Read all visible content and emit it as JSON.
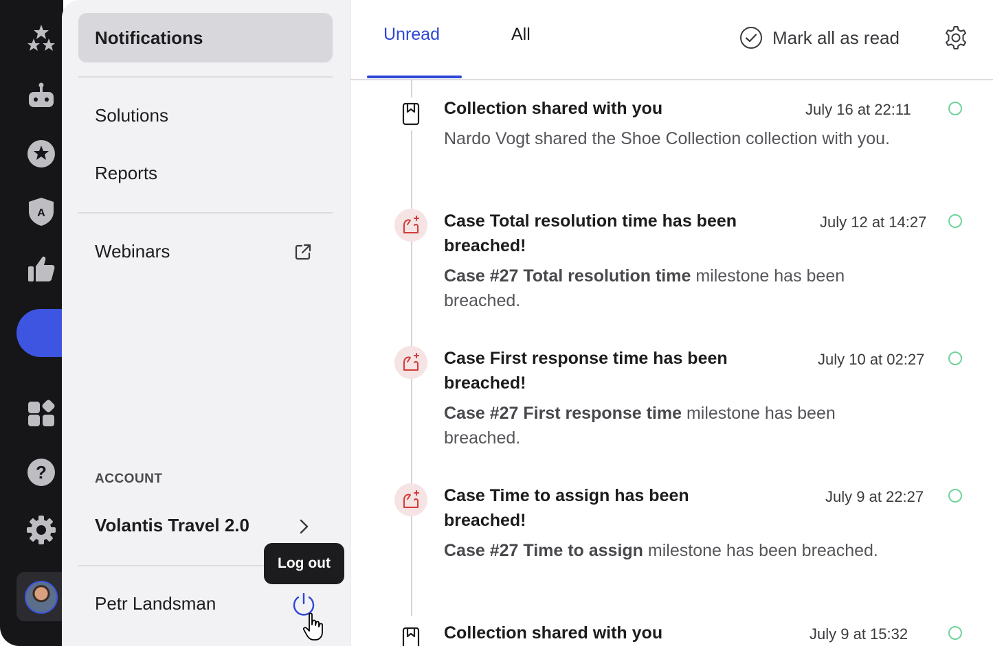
{
  "sidebar": {
    "items": [
      {
        "label": "Notifications"
      },
      {
        "label": "Solutions"
      },
      {
        "label": "Reports"
      },
      {
        "label": "Webinars"
      }
    ],
    "account_section_label": "ACCOUNT",
    "account_name": "Volantis Travel 2.0",
    "user_name": "Petr Landsman",
    "logout_tooltip": "Log out"
  },
  "header": {
    "tabs": [
      {
        "label": "Unread"
      },
      {
        "label": "All"
      }
    ],
    "mark_all_label": "Mark all as read"
  },
  "notifications": [
    {
      "icon": "bookmark-icon",
      "title": "Collection shared with you",
      "time": "July 16 at 22:11",
      "body": "Nardo Vogt shared the Shoe Collection collection with you."
    },
    {
      "icon": "alarm-icon",
      "title": "Case Total resolution time has been breached!",
      "time": "July 12 at 14:27",
      "body_bold": "Case #27 Total resolution time",
      "body": " milestone has been breached."
    },
    {
      "icon": "alarm-icon",
      "title": "Case First response time has been breached!",
      "time": "July 10 at 02:27",
      "body_bold": "Case #27 First response time",
      "body": " milestone has been breached."
    },
    {
      "icon": "alarm-icon",
      "title": "Case Time to assign has been breached!",
      "time": "July 9 at 22:27",
      "body_bold": "Case #27 Time to assign",
      "body": " milestone has been breached."
    },
    {
      "icon": "bookmark-icon",
      "title": "Collection shared with you",
      "time": "July 9 at 15:32"
    }
  ],
  "colors": {
    "accent": "#2e47d6",
    "unread_dot": "#6fd39a",
    "rail_bg": "#161619"
  }
}
